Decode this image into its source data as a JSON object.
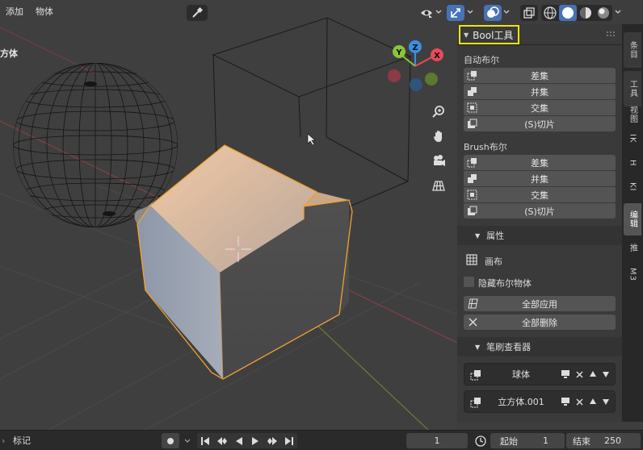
{
  "header": {
    "menu_add": "添加",
    "menu_object": "物体",
    "icons": [
      "eyedropper-icon",
      "visibility-icon",
      "gizmo-icon",
      "overlay-icon",
      "xray-icon",
      "shading-wireframe-icon",
      "shading-solid-icon",
      "shading-material-icon",
      "shading-rendered-icon"
    ]
  },
  "viewport": {
    "object_label": "方体"
  },
  "sidebar": {
    "panel_title": "Bool工具",
    "auto_boolean": {
      "label": "自动布尔",
      "buttons": [
        "差集",
        "并集",
        "交集",
        "(S)切片"
      ]
    },
    "brush_boolean": {
      "label": "Brush布尔",
      "buttons": [
        "差集",
        "并集",
        "交集",
        "(S)切片"
      ]
    },
    "properties": {
      "label": "属性",
      "canvas": "画布",
      "hide_boolean_objects": "隐藏布尔物体",
      "apply_all": "全部应用",
      "delete_all": "全部删除"
    },
    "brush_viewer": {
      "label": "笔刷查看器",
      "items": [
        "球体",
        "立方体.001"
      ]
    }
  },
  "tabs": [
    "条目",
    "工具",
    "视图",
    "IK",
    "H",
    "KI",
    "编辑",
    "推",
    "M3"
  ],
  "timeline": {
    "marker": "标记",
    "current_frame": "1",
    "start_label": "起始",
    "start_value": "1",
    "end_label": "结束",
    "end_value": "250"
  },
  "colors": {
    "accent_blue": "#4772b3",
    "highlight_yellow": "#f2e600",
    "selection_orange": "#f0a030",
    "axis_x": "#e64b5b",
    "axis_y": "#8ac53a",
    "axis_z": "#3d8fe0"
  }
}
